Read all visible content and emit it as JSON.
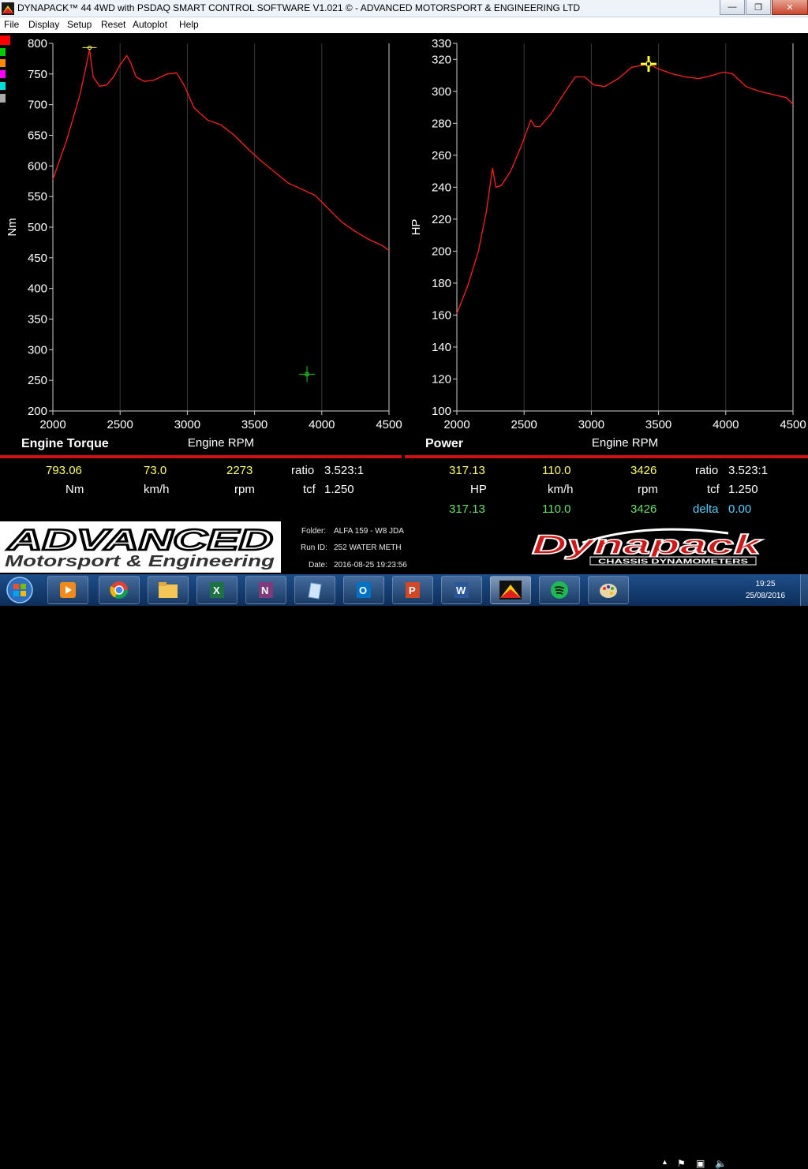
{
  "window": {
    "title": "DYNAPACK™ 44 4WD with PSDAQ SMART CONTROL SOFTWARE V1.021 © - ADVANCED MOTORSPORT & ENGINEERING LTD",
    "minimize_label": "—",
    "maximize_label": "❐",
    "close_label": "✕"
  },
  "menu": [
    "File",
    "Display",
    "Setup",
    "Reset",
    "Autoplot",
    "Help"
  ],
  "legend_colors": [
    "#ff0000",
    "#00cc00",
    "#ff8800",
    "#ff00ff",
    "#00dddd",
    "#aaaaaa"
  ],
  "left_panel": {
    "title": "Engine Torque",
    "readout": {
      "value": "793.06",
      "speed": "73.0",
      "rpm": "2273",
      "ratio_label": "ratio",
      "ratio": "3.523:1",
      "unit": "Nm",
      "speed_unit": "km/h",
      "rpm_unit": "rpm",
      "tcf_label": "tcf",
      "tcf": "1.250"
    }
  },
  "right_panel": {
    "title": "Power",
    "readout": {
      "value": "317.13",
      "speed": "110.0",
      "rpm": "3426",
      "ratio_label": "ratio",
      "ratio": "3.523:1",
      "unit": "HP",
      "speed_unit": "km/h",
      "rpm_unit": "rpm",
      "tcf_label": "tcf",
      "tcf": "1.250",
      "value2": "317.13",
      "speed2": "110.0",
      "rpm2": "3426",
      "delta_label": "delta",
      "delta": "0.00"
    }
  },
  "chart_data": [
    {
      "type": "line",
      "title": "",
      "xlabel": "Engine RPM",
      "ylabel": "Nm",
      "xlim": [
        2000,
        4500
      ],
      "ylim": [
        200,
        800
      ],
      "xticks": [
        "2000",
        "2500",
        "3000",
        "3500",
        "4000",
        "4500"
      ],
      "yticks": [
        "800",
        "750",
        "700",
        "650",
        "600",
        "550",
        "500",
        "450",
        "400",
        "350",
        "300",
        "250",
        "200"
      ],
      "color": "#ff2020",
      "x": [
        2000,
        2100,
        2200,
        2240,
        2273,
        2300,
        2350,
        2400,
        2450,
        2500,
        2550,
        2580,
        2620,
        2680,
        2750,
        2850,
        2920,
        2980,
        3050,
        3150,
        3250,
        3350,
        3450,
        3550,
        3650,
        3750,
        3850,
        3950,
        4050,
        4150,
        4250,
        4350,
        4450,
        4500
      ],
      "y": [
        578,
        640,
        715,
        755,
        790,
        745,
        730,
        732,
        745,
        765,
        780,
        768,
        745,
        738,
        740,
        750,
        752,
        730,
        695,
        675,
        667,
        650,
        628,
        608,
        590,
        572,
        562,
        552,
        530,
        508,
        493,
        480,
        470,
        462
      ],
      "cursor_peak": {
        "x": 2273,
        "y": 793
      },
      "cursor_marker": {
        "x": 3890,
        "y": 260
      }
    },
    {
      "type": "line",
      "title": "",
      "xlabel": "Engine RPM",
      "ylabel": "HP",
      "xlim": [
        2000,
        4500
      ],
      "ylim": [
        100,
        330
      ],
      "xticks": [
        "2000",
        "2500",
        "3000",
        "3500",
        "4000",
        "4500"
      ],
      "yticks": [
        "330",
        "320",
        "300",
        "280",
        "260",
        "240",
        "220",
        "200",
        "180",
        "160",
        "140",
        "120",
        "100"
      ],
      "color": "#ff2020",
      "x": [
        2000,
        2080,
        2160,
        2220,
        2265,
        2290,
        2330,
        2400,
        2480,
        2550,
        2580,
        2620,
        2700,
        2800,
        2880,
        2950,
        3020,
        3100,
        3200,
        3300,
        3426,
        3500,
        3600,
        3700,
        3800,
        3900,
        3980,
        4050,
        4150,
        4250,
        4350,
        4450,
        4500
      ],
      "y": [
        161,
        178,
        200,
        225,
        252,
        240,
        241,
        250,
        266,
        282,
        278,
        278,
        286,
        299,
        309,
        309,
        304,
        303,
        308,
        315,
        317.13,
        314,
        311,
        309,
        308,
        310,
        312,
        311,
        303,
        300,
        298,
        296,
        292
      ],
      "cursor_peak": {
        "x": 3426,
        "y": 317.13
      }
    }
  ],
  "logo": {
    "line1": "ADVANCED",
    "line2": "Motorsport & Engineering"
  },
  "run_info": {
    "folder_label": "Folder:",
    "folder": "ALFA 159 - W8 JDA",
    "runid_label": "Run ID:",
    "runid": "252 WATER METH",
    "date_label": "Date:",
    "date": "2016-08-25 19:23:56"
  },
  "brand": {
    "name": "Dynapack",
    "tagline": "CHASSIS DYNAMOMETERS"
  },
  "taskbar": {
    "apps": [
      "start-orb",
      "media-player",
      "chrome",
      "file-explorer",
      "excel",
      "onenote",
      "notes",
      "outlook",
      "powerpoint",
      "word",
      "dynapack",
      "spotify",
      "paint"
    ],
    "time": "19:25",
    "date": "25/08/2016"
  }
}
